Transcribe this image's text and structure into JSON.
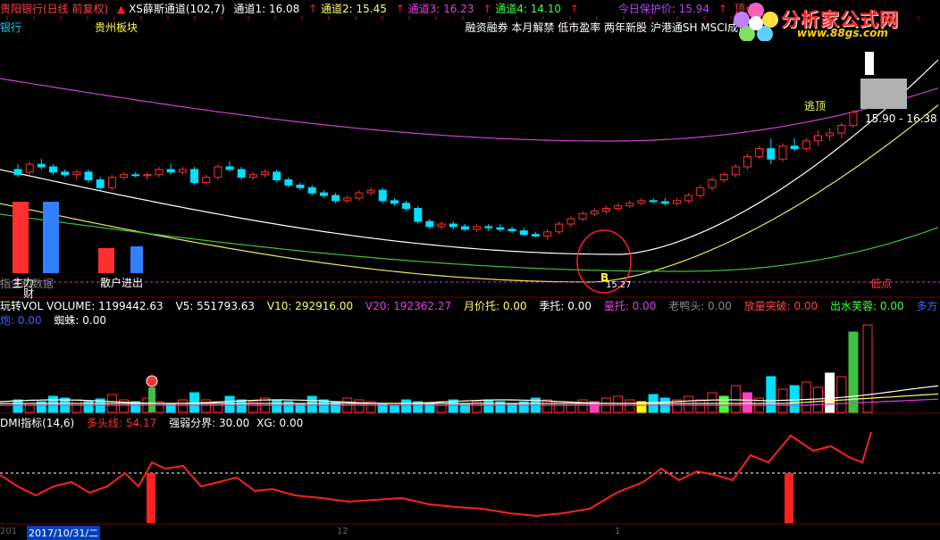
{
  "header": {
    "stock": "贵阳银行(日线 前复权)",
    "indicator": "XS薛斯通道(102,7)",
    "ch1": "通道1: 16.08",
    "ch2": "通道2: 15.45",
    "ch3": "通道3: 16.23",
    "ch4": "通道4: 14.10",
    "protect": "今日保护价: 15.94",
    "top": "顶点"
  },
  "sub_header": {
    "left": "银行",
    "sector": "贵州板块",
    "tags": "融资融券 本月解禁 低市盈率 两年新股 沪港通SH MSCI成份 中"
  },
  "logo": {
    "name": "分析家公式网",
    "url": "www.88gs.com"
  },
  "price_panel": {
    "escape_top": "逃顶",
    "range": "15.90 - 16.38",
    "low_point": "低点",
    "zhuli_label": "主力",
    "sanhu_label": "散户进出",
    "overlay_text": "指主和数据",
    "overlay_text2": "财",
    "b_marker": "B",
    "val_marker": "15.27"
  },
  "volume_panel": {
    "title": "玩转VOL",
    "volume": "VOLUME: 1199442.63",
    "v5": "V5: 551793.63",
    "v10": "V10: 292916.00",
    "v20": "V20: 192362.27",
    "yuejiatuo": "月价托: 0.00",
    "jituo": "季托: 0.00",
    "liangtuo": "量托: 0.00",
    "laoyatou": "老鸭头: 0.00",
    "fangliang": "放量突破: 0.00",
    "chushui": "出水芙蓉: 0.00",
    "duofangpao": "多方炮: 0.00",
    "zhizhu": "蜘蛛: 0.00"
  },
  "dmi_panel": {
    "title": "DMI指标(14,6)",
    "duotou": "多头线: 54.17",
    "fenjie": "强弱分界: 30.00",
    "xg": "XG: 0.00"
  },
  "footer": {
    "date": "2017/10/31/二",
    "year": "201",
    "m12": "12",
    "m1": "1"
  },
  "colors": {
    "up": "#ff3030",
    "down": "#00e0ff",
    "magenta": "#e040e0",
    "yellow": "#e8e860",
    "green": "#40c040",
    "white": "#ffffff",
    "dash": "#d040d0"
  },
  "chart_data": {
    "type": "candlestick",
    "candles_note": "Daily candles; values in price units",
    "ylim": [
      13.8,
      17.2
    ],
    "candles": [
      [
        16.0,
        16.1,
        15.85,
        15.9
      ],
      [
        15.95,
        16.15,
        15.9,
        16.1
      ],
      [
        16.1,
        16.2,
        16.0,
        16.05
      ],
      [
        16.05,
        16.1,
        15.9,
        15.95
      ],
      [
        15.95,
        16.0,
        15.85,
        15.9
      ],
      [
        15.9,
        16.0,
        15.8,
        15.95
      ],
      [
        15.95,
        16.0,
        15.75,
        15.8
      ],
      [
        15.8,
        15.85,
        15.6,
        15.65
      ],
      [
        15.65,
        15.9,
        15.6,
        15.85
      ],
      [
        15.85,
        15.95,
        15.8,
        15.9
      ],
      [
        15.9,
        15.95,
        15.85,
        15.88
      ],
      [
        15.88,
        15.95,
        15.8,
        15.9
      ],
      [
        15.9,
        16.05,
        15.85,
        16.0
      ],
      [
        16.0,
        16.1,
        15.9,
        15.95
      ],
      [
        15.95,
        16.05,
        15.9,
        16.0
      ],
      [
        16.0,
        16.05,
        15.7,
        15.75
      ],
      [
        15.75,
        15.9,
        15.7,
        15.85
      ],
      [
        15.85,
        16.1,
        15.8,
        16.05
      ],
      [
        16.05,
        16.15,
        15.95,
        16.0
      ],
      [
        16.0,
        16.05,
        15.8,
        15.85
      ],
      [
        15.85,
        15.95,
        15.8,
        15.9
      ],
      [
        15.9,
        16.0,
        15.85,
        15.95
      ],
      [
        15.95,
        16.0,
        15.75,
        15.8
      ],
      [
        15.8,
        15.85,
        15.65,
        15.7
      ],
      [
        15.7,
        15.75,
        15.6,
        15.65
      ],
      [
        15.65,
        15.7,
        15.5,
        15.55
      ],
      [
        15.55,
        15.6,
        15.45,
        15.5
      ],
      [
        15.5,
        15.55,
        15.35,
        15.4
      ],
      [
        15.4,
        15.5,
        15.35,
        15.45
      ],
      [
        15.45,
        15.6,
        15.4,
        15.55
      ],
      [
        15.55,
        15.65,
        15.5,
        15.6
      ],
      [
        15.6,
        15.65,
        15.35,
        15.4
      ],
      [
        15.4,
        15.45,
        15.3,
        15.35
      ],
      [
        15.35,
        15.4,
        15.2,
        15.25
      ],
      [
        15.25,
        15.3,
        14.95,
        15.0
      ],
      [
        15.0,
        15.05,
        14.85,
        14.9
      ],
      [
        14.9,
        15.0,
        14.85,
        14.95
      ],
      [
        14.95,
        15.0,
        14.85,
        14.9
      ],
      [
        14.9,
        14.95,
        14.82,
        14.85
      ],
      [
        14.85,
        14.95,
        14.8,
        14.9
      ],
      [
        14.9,
        14.95,
        14.82,
        14.88
      ],
      [
        14.88,
        14.95,
        14.8,
        14.85
      ],
      [
        14.85,
        14.9,
        14.78,
        14.82
      ],
      [
        14.82,
        14.88,
        14.72,
        14.75
      ],
      [
        14.75,
        14.8,
        14.7,
        14.72
      ],
      [
        14.72,
        14.85,
        14.65,
        14.8
      ],
      [
        14.8,
        15.0,
        14.75,
        14.95
      ],
      [
        14.95,
        15.1,
        14.9,
        15.05
      ],
      [
        15.05,
        15.2,
        15.0,
        15.15
      ],
      [
        15.15,
        15.25,
        15.1,
        15.2
      ],
      [
        15.2,
        15.3,
        15.15,
        15.25
      ],
      [
        15.25,
        15.35,
        15.2,
        15.3
      ],
      [
        15.3,
        15.4,
        15.25,
        15.35
      ],
      [
        15.35,
        15.45,
        15.3,
        15.4
      ],
      [
        15.4,
        15.45,
        15.35,
        15.38
      ],
      [
        15.38,
        15.45,
        15.3,
        15.35
      ],
      [
        15.35,
        15.45,
        15.3,
        15.4
      ],
      [
        15.4,
        15.55,
        15.35,
        15.5
      ],
      [
        15.5,
        15.7,
        15.45,
        15.65
      ],
      [
        15.65,
        15.85,
        15.6,
        15.8
      ],
      [
        15.8,
        15.95,
        15.75,
        15.9
      ],
      [
        15.9,
        16.1,
        15.85,
        16.05
      ],
      [
        16.05,
        16.3,
        16.0,
        16.25
      ],
      [
        16.25,
        16.45,
        16.2,
        16.4
      ],
      [
        16.4,
        16.6,
        16.1,
        16.2
      ],
      [
        16.2,
        16.5,
        16.15,
        16.45
      ],
      [
        16.45,
        16.6,
        16.35,
        16.4
      ],
      [
        16.4,
        16.6,
        16.35,
        16.55
      ],
      [
        16.55,
        16.75,
        16.45,
        16.65
      ],
      [
        16.65,
        16.8,
        16.55,
        16.7
      ],
      [
        16.7,
        16.9,
        16.6,
        16.85
      ],
      [
        16.85,
        17.15,
        16.8,
        17.1
      ]
    ]
  }
}
